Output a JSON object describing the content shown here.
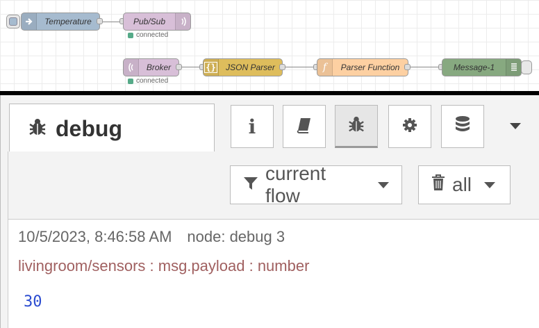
{
  "flow": {
    "nodes": [
      {
        "id": "temperature",
        "label": "Temperature",
        "color": "#a6bbcf",
        "icon": "arrow-right-icon"
      },
      {
        "id": "pubsub",
        "label": "Pub/Sub",
        "color": "#d8bfd8",
        "icon": "radio-waves-icon",
        "status": "connected"
      },
      {
        "id": "broker",
        "label": "Broker",
        "color": "#d8bfd8",
        "icon": "radio-waves-icon",
        "status": "connected"
      },
      {
        "id": "json-parser",
        "label": "JSON Parser",
        "color": "#debd5c",
        "icon": "braces-icon"
      },
      {
        "id": "parser-function",
        "label": "Parser Function",
        "color": "#fdd0a2",
        "icon": "function-icon"
      },
      {
        "id": "message-1",
        "label": "Message-1",
        "color": "#87a980",
        "icon": "list-icon"
      }
    ]
  },
  "sidebar": {
    "tab_label": "debug",
    "tab_icon": "bug-icon",
    "buttons": [
      {
        "name": "info",
        "icon": "info-icon"
      },
      {
        "name": "help",
        "icon": "book-icon"
      },
      {
        "name": "debug",
        "icon": "bug-icon",
        "selected": true
      },
      {
        "name": "config",
        "icon": "gear-icon"
      },
      {
        "name": "context",
        "icon": "database-icon"
      }
    ],
    "filter": {
      "label": "current flow",
      "icon": "filter-icon"
    },
    "clear": {
      "label": "all",
      "icon": "trash-icon"
    }
  },
  "message": {
    "timestamp": "10/5/2023, 8:46:58 AM",
    "node": "node: debug 3",
    "topic": "livingroom/sensors : msg.payload : number",
    "value": "30"
  }
}
